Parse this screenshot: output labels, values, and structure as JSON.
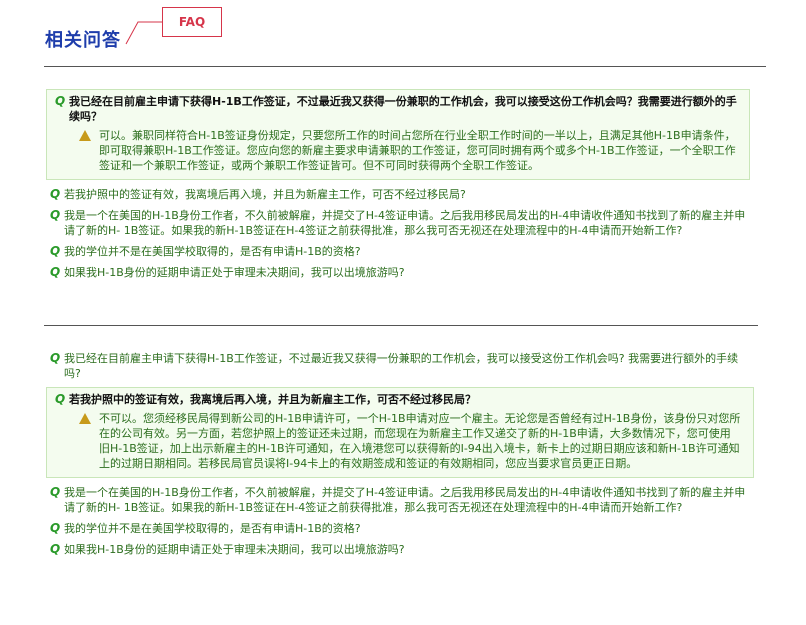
{
  "header": {
    "title": "相关问答",
    "faq_label": "FAQ"
  },
  "panel1": {
    "open_question": "我已经在目前雇主申请下获得H-1B工作签证，不过最近我又获得一份兼职的工作机会，我可以接受这份工作机会吗？我需要进行额外的手续吗？",
    "answer": "可以。兼职同样符合H-1B签证身份规定，只要您所工作的时间占您所在行业全职工作时间的一半以上，且满足其他H-1B申请条件，即可取得兼职H-1B工作签证。您应向您的新雇主要求申请兼职的工作签证，您可同时拥有两个或多个H-1B工作签证，一个全职工作签证和一个兼职工作签证，或两个兼职工作签证皆可。但不可同时获得两个全职工作签证。",
    "questions": [
      "若我护照中的签证有效，我离境后再入境，并且为新雇主工作，可否不经过移民局?",
      "我是一个在美国的H-1B身份工作者，不久前被解雇，并提交了H-4签证申请。之后我用移民局发出的H-4申请收件通知书找到了新的雇主并申请了新的H- 1B签证。如果我的新H-1B签证在H-4签证之前获得批准，那么我可否无视还在处理流程中的H-4申请而开始新工作?",
      "我的学位并不是在美国学校取得的，是否有申请H-1B的资格?",
      "如果我H-1B身份的延期申请正处于审理未决期间，我可以出境旅游吗?"
    ]
  },
  "panel2": {
    "first_question": "我已经在目前雇主申请下获得H-1B工作签证，不过最近我又获得一份兼职的工作机会，我可以接受这份工作机会吗? 我需要进行额外的手续吗?",
    "open_question": "若我护照中的签证有效，我离境后再入境，并且为新雇主工作，可否不经过移民局？",
    "answer": "不可以。您须经移民局得到新公司的H-1B申请许可，一个H-1B申请对应一个雇主。无论您是否曾经有过H-1B身份，该身份只对您所在的公司有效。另一方面，若您护照上的签证还未过期，而您现在为新雇主工作又递交了新的H-1B申请，大多数情况下，您可使用旧H-1B签证，加上出示新雇主的H-1B许可通知，在入境港您可以获得新的I-94出入境卡，新卡上的过期日期应该和新H-1B许可通知上的过期日期相同。若移民局官员误将I-94卡上的有效期签成和签证的有效期相同，您应当要求官员更正日期。",
    "questions": [
      "我是一个在美国的H-1B身份工作者，不久前被解雇，并提交了H-4签证申请。之后我用移民局发出的H-4申请收件通知书找到了新的雇主并申请了新的H- 1B签证。如果我的新H-1B签证在H-4签证之前获得批准，那么我可否无视还在处理流程中的H-4申请而开始新工作?",
      "我的学位并不是在美国学校取得的，是否有申请H-1B的资格?",
      "如果我H-1B身份的延期申请正处于审理未决期间，我可以出境旅游吗?"
    ]
  }
}
